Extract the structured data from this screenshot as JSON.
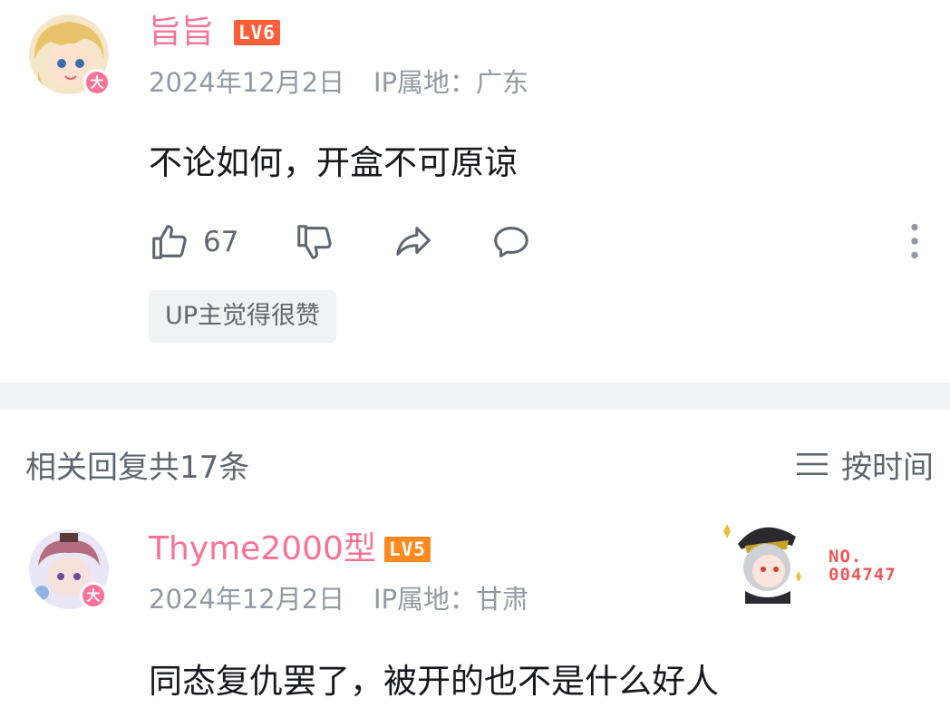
{
  "comment": {
    "username": "旨旨",
    "level": "LV6",
    "date": "2024年12月2日",
    "ip": "IP属地：广东",
    "text": "不论如何，开盒不可原谅",
    "likes": "67",
    "up_tag": "UP主觉得很赞",
    "avatar_badge": "大"
  },
  "replies": {
    "title": "相关回复共17条",
    "sort_label": "按时间"
  },
  "reply": {
    "username": "Thyme2000型",
    "level": "LV5",
    "date": "2024年12月2日",
    "ip": "IP属地：甘肃",
    "text": "同态复仇罢了，被开的也不是什么好人",
    "avatar_badge": "大",
    "fan_badge": {
      "line1": "NO.",
      "line2": "004747"
    }
  },
  "colors": {
    "username": "#fb7299",
    "lv6": "#ff5e3a",
    "lv5": "#ff8a1f",
    "meta": "#9499a0",
    "fan_number": "#f05555"
  },
  "icons": [
    "like-icon",
    "dislike-icon",
    "share-icon",
    "reply-icon",
    "more-icon",
    "sort-icon"
  ]
}
